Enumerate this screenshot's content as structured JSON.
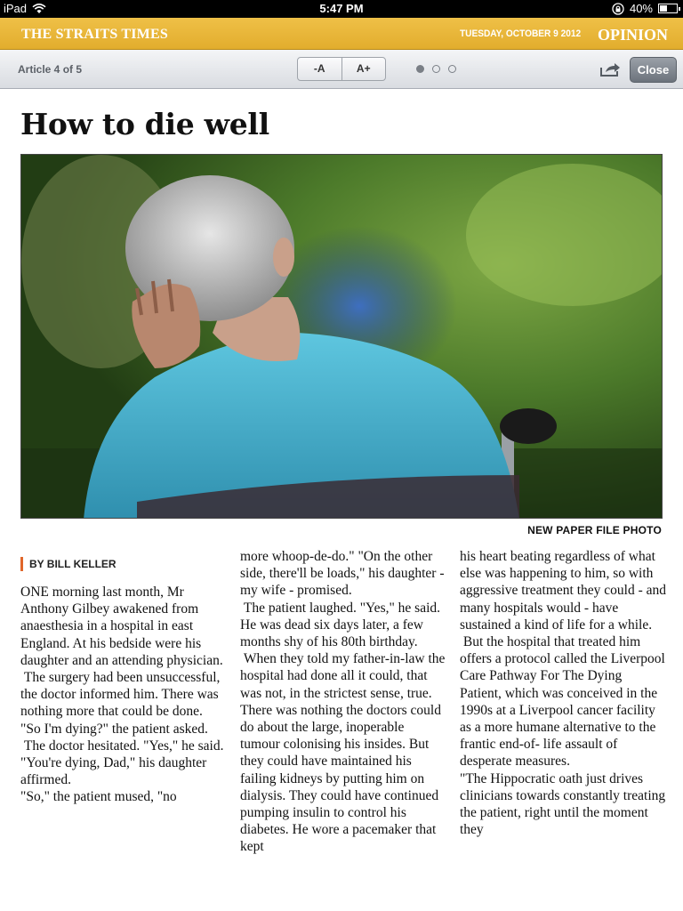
{
  "status_bar": {
    "device": "iPad",
    "time": "5:47 PM",
    "battery": "40%",
    "battery_level": 0.4
  },
  "masthead": {
    "brand": "THE STRAITS TIMES",
    "date": "TUESDAY, OCTOBER 9 2012",
    "section": "OPINION",
    "accent_color": "#e9b73a"
  },
  "toolbar": {
    "article_counter": "Article 4 of 5",
    "font_decrease": "-A",
    "font_increase": "A+",
    "close_label": "Close",
    "page_dots": 3,
    "active_dot": 1,
    "share_icon": "share-icon"
  },
  "article": {
    "headline": "How to die well",
    "photo_credit": "NEW PAPER FILE PHOTO",
    "byline": "BY BILL KELLER",
    "byline_accent": "#e0662a",
    "columns": [
      [
        "ONE morning last month, Mr Anthony Gilbey awakened from anaesthesia in a hospital in east England. At his bedside were his daughter and an attending physician.",
        " The surgery had been unsuccessful, the doctor informed him. There was nothing more that could be done.",
        "\"So I'm dying?\" the patient asked.",
        " The doctor hesitated. \"Yes,\" he said.",
        "\"You're dying, Dad,\" his daughter affirmed.",
        "\"So,\" the patient mused, \"no"
      ],
      [
        "more whoop-de-do.\" \"On the other side, there'll be loads,\" his daughter - my wife - promised.",
        " The patient laughed. \"Yes,\" he said. He was dead six days later, a few months shy of his 80th birthday.",
        " When they told my father-in-law the hospital had done all it could, that was not, in the strictest sense, true. There was nothing the doctors could do about the large, inoperable tumour colonising his insides. But they could have maintained his failing kidneys by putting him on dialysis. They could have continued pumping insulin to control his diabetes. He wore a pacemaker that kept"
      ],
      [
        "his heart beating regardless of what else was happening to him, so with aggressive treatment they could - and many hospitals would - have sustained a kind of life for a while.",
        " But the hospital that treated him offers a protocol called the Liverpool Care Pathway For The Dying Patient, which was conceived in the 1990s at a Liverpool cancer facility as a more humane alternative to the frantic end-of- life assault of desperate measures.",
        "\"The Hippocratic oath just drives clinicians towards constantly treating the patient, right until the moment they"
      ]
    ]
  }
}
